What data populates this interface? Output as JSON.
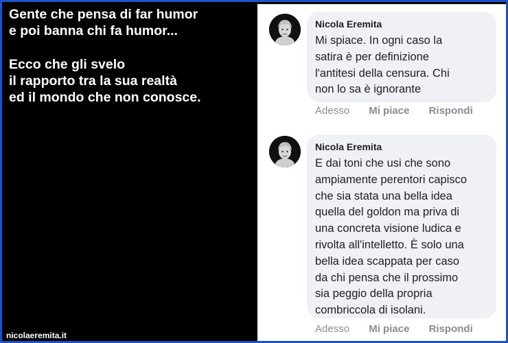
{
  "caption": {
    "text": "Gente che pensa di far humor\ne poi banna chi fa humor...\n\nEcco che gli svelo\nil rapporto tra la sua realtà\ned il mondo che non conosce."
  },
  "watermark": "nicolaeremita.it",
  "comments": [
    {
      "author": "Nicola Eremita",
      "text": "Mi spiace. In ogni caso la\nsatira è per definizione\nl'antitesi della censura. Chi\nnon lo sa è ignorante",
      "time": "Adesso",
      "like": "Mi piace",
      "reply": "Rispondi"
    },
    {
      "author": "Nicola Eremita",
      "text": "E dai toni che usi che sono\nampiamente perentori capisco\nche sia stata una bella idea\nquella del goldon ma priva di\nuna concreta visione ludica e\nrivolta all'intelletto. È solo una\nbella idea scappata per caso\nda chi pensa che il prossimo\nsia peggio della propria\ncombriccola di isolani.",
      "time": "Adesso",
      "like": "Mi piace",
      "reply": "Rispondi"
    }
  ],
  "colors": {
    "border": "#1a53c8",
    "bubble": "#eff1f4",
    "meta_text": "#8a8d91"
  },
  "icons": {
    "avatar": "profile-avatar"
  }
}
